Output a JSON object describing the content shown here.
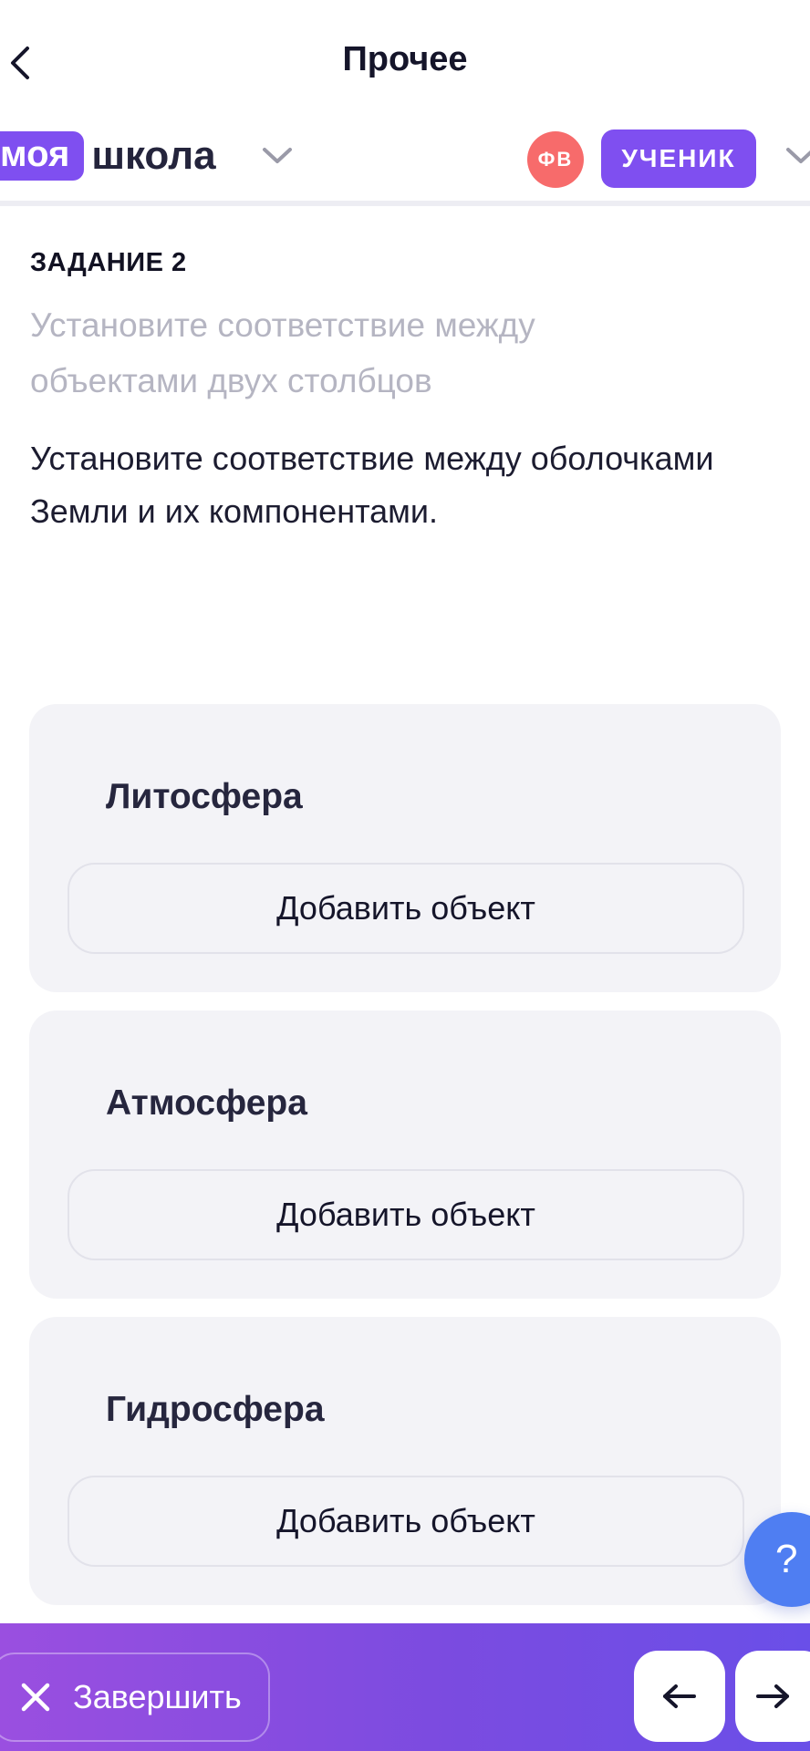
{
  "header": {
    "title": "Прочее"
  },
  "school": {
    "logo_badge": "моя",
    "logo_text": "школа",
    "avatar_initials": "ФВ",
    "role": "УЧЕНИК"
  },
  "task": {
    "label": "ЗАДАНИЕ 2",
    "hint": "Установите соответствие между объектами двух столбцов",
    "question": "Установите соответствие между оболочками Земли и их компонентами."
  },
  "groups": [
    {
      "title": "Литосфера",
      "add_label": "Добавить объект"
    },
    {
      "title": "Атмосфера",
      "add_label": "Добавить объект"
    },
    {
      "title": "Гидросфера",
      "add_label": "Добавить объект"
    }
  ],
  "help": {
    "label": "?"
  },
  "footer": {
    "finish_label": "Завершить"
  },
  "colors": {
    "accent": "#7f4ff0",
    "avatar": "#f76b6b",
    "help": "#4f7ef2",
    "card_bg": "#f3f3f7"
  }
}
